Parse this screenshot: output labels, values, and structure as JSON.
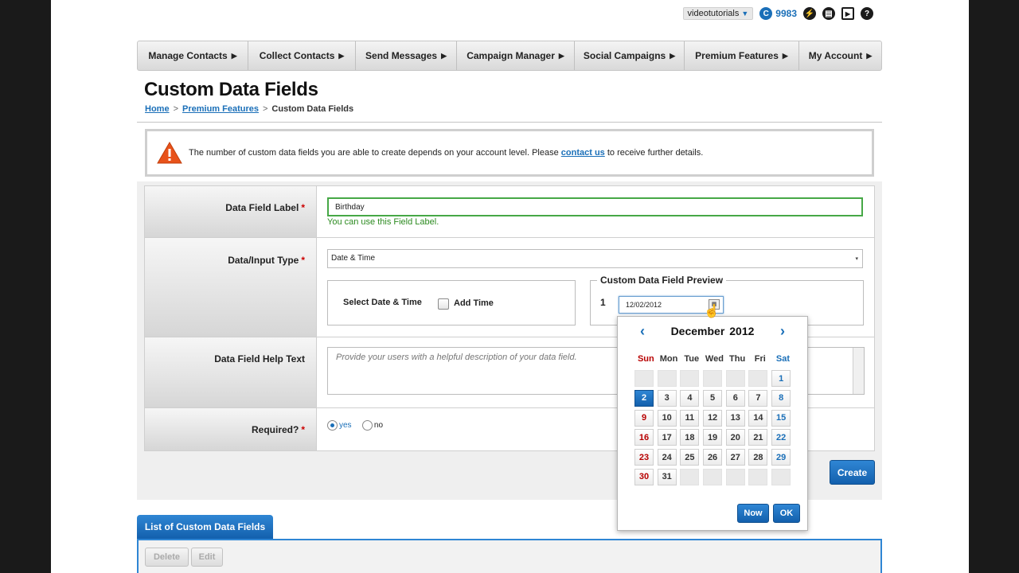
{
  "userbar": {
    "account": "videotutorials",
    "credit_badge": "C",
    "credits": "9983"
  },
  "nav": {
    "items": [
      {
        "label": "Manage Contacts"
      },
      {
        "label": "Collect Contacts"
      },
      {
        "label": "Send Messages"
      },
      {
        "label": "Campaign Manager"
      },
      {
        "label": "Social Campaigns"
      },
      {
        "label": "Premium Features"
      },
      {
        "label": "My Account"
      }
    ],
    "arrow": "▶"
  },
  "page": {
    "title": "Custom Data Fields",
    "breadcrumb": {
      "home": "Home",
      "premium": "Premium Features",
      "current": "Custom Data Fields",
      "sep": ">"
    }
  },
  "notice": {
    "text_before": "The number of custom data fields you are able to create depends on your account level. Please ",
    "link": "contact us",
    "text_after": " to receive further details."
  },
  "form": {
    "required_mark": "*",
    "label_field": {
      "label": "Data Field Label",
      "value": "Birthday",
      "ok_message": "You can use this Field Label."
    },
    "type_field": {
      "label": "Data/Input Type",
      "value": "Date & Time",
      "caret": "▾",
      "date_box_label": "Select Date & Time",
      "add_time_label": "Add Time",
      "preview_title": "Custom Data Field Preview",
      "preview_index": "1",
      "preview_value": "12/02/2012"
    },
    "help_field": {
      "label": "Data Field Help Text",
      "placeholder": "Provide your users with a helpful description of your data field."
    },
    "required_field": {
      "label": "Required?",
      "yes": "yes",
      "no": "no"
    },
    "create_label": "Create"
  },
  "calendar": {
    "month": "December",
    "year": "2012",
    "prev": "‹",
    "next": "›",
    "dow": [
      "Sun",
      "Mon",
      "Tue",
      "Wed",
      "Thu",
      "Fri",
      "Sat"
    ],
    "leading_blanks": 6,
    "days": 31,
    "selected": 2,
    "now_label": "Now",
    "ok_label": "OK"
  },
  "list": {
    "tab_label": "List of Custom Data Fields",
    "delete_label": "Delete",
    "edit_label": "Edit"
  },
  "colors": {
    "accent": "#1a6fb8",
    "success": "#2b8a1f",
    "required": "#cc0000",
    "warning": "#e8521a"
  }
}
